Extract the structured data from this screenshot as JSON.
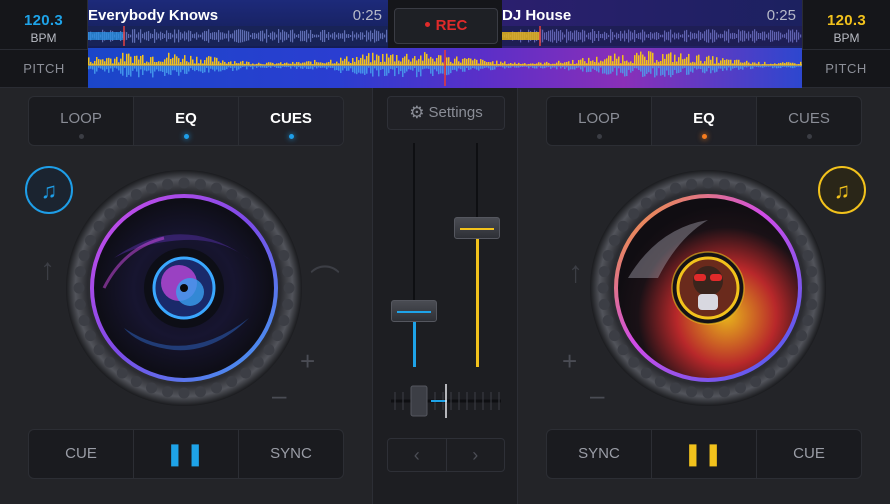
{
  "deck_a": {
    "bpm": "120.3",
    "bpm_unit": "BPM",
    "pitch": "PITCH",
    "track_title": "Everybody Knows",
    "time": "0:25",
    "tabs": [
      {
        "label": "LOOP",
        "active": false
      },
      {
        "label": "EQ",
        "active": true
      },
      {
        "label": "CUES",
        "active": true
      }
    ],
    "transport": {
      "cue": "CUE",
      "play": "❚❚",
      "sync": "SYNC"
    },
    "accent": "#1ea3e8",
    "pitch_plus": "+",
    "pitch_minus": "–"
  },
  "deck_b": {
    "bpm": "120.3",
    "bpm_unit": "BPM",
    "pitch": "PITCH",
    "track_title": "DJ House",
    "time": "0:25",
    "tabs": [
      {
        "label": "LOOP",
        "active": false
      },
      {
        "label": "EQ",
        "active": true
      },
      {
        "label": "CUES",
        "active": false
      }
    ],
    "transport": {
      "sync": "SYNC",
      "play": "❚❚",
      "cue": "CUE"
    },
    "accent": "#f2c21c",
    "pitch_plus": "+",
    "pitch_minus": "–"
  },
  "rec": {
    "label": "REC",
    "color": "#e02a2a"
  },
  "mixer": {
    "settings_label": "Settings",
    "left_volume": 0.25,
    "right_volume": 0.62,
    "crossfader": 0.4,
    "nav_prev": "‹",
    "nav_next": "›"
  },
  "icons": [
    "music-note-add-icon",
    "gear-icon",
    "pitch-up-arrow-icon",
    "chevron-left-icon",
    "chevron-right-icon"
  ]
}
